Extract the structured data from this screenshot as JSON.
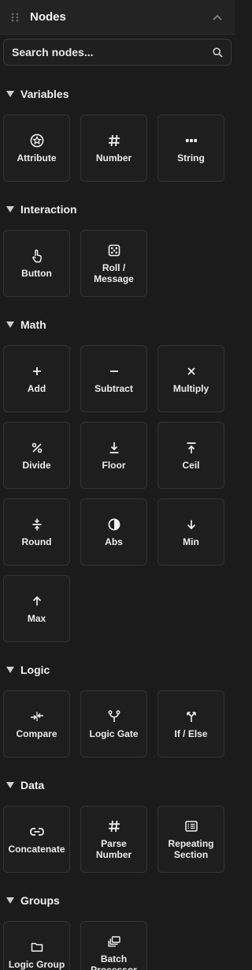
{
  "header": {
    "title": "Nodes"
  },
  "search": {
    "placeholder": "Search nodes..."
  },
  "sections": {
    "variables": {
      "title": "Variables",
      "items": [
        "Attribute",
        "Number",
        "String"
      ]
    },
    "interaction": {
      "title": "Interaction",
      "items": [
        "Button",
        "Roll / Message"
      ]
    },
    "math": {
      "title": "Math",
      "items": [
        "Add",
        "Subtract",
        "Multiply",
        "Divide",
        "Floor",
        "Ceil",
        "Round",
        "Abs",
        "Min",
        "Max"
      ]
    },
    "logic": {
      "title": "Logic",
      "items": [
        "Compare",
        "Logic Gate",
        "If / Else"
      ]
    },
    "data": {
      "title": "Data",
      "items": [
        "Concatenate",
        "Parse Number",
        "Repeating Section"
      ]
    },
    "groups": {
      "title": "Groups",
      "items": [
        "Logic Group",
        "Batch Processor"
      ]
    }
  },
  "icons": {
    "attribute": "star-circle-icon",
    "number": "hash-icon",
    "string": "abc-icon",
    "button": "pointer-icon",
    "roll": "dice-icon",
    "add": "plus-icon",
    "subtract": "minus-icon",
    "multiply": "times-icon",
    "divide": "percent-icon",
    "floor": "floor-icon",
    "ceil": "ceil-icon",
    "round": "round-icon",
    "abs": "half-circle-icon",
    "min": "arrow-down-icon",
    "max": "arrow-up-icon",
    "compare": "compare-icon",
    "logic_gate": "fork-icon",
    "if_else": "split-icon",
    "concatenate": "link-icon",
    "parse_number": "hash-icon",
    "repeating_section": "list-icon",
    "logic_group": "folder-icon",
    "batch_processor": "stack-icon"
  },
  "colors": {
    "background": "#1b1b1b",
    "header": "#232323",
    "tile_border": "#343434",
    "text": "#e8e8e8"
  }
}
